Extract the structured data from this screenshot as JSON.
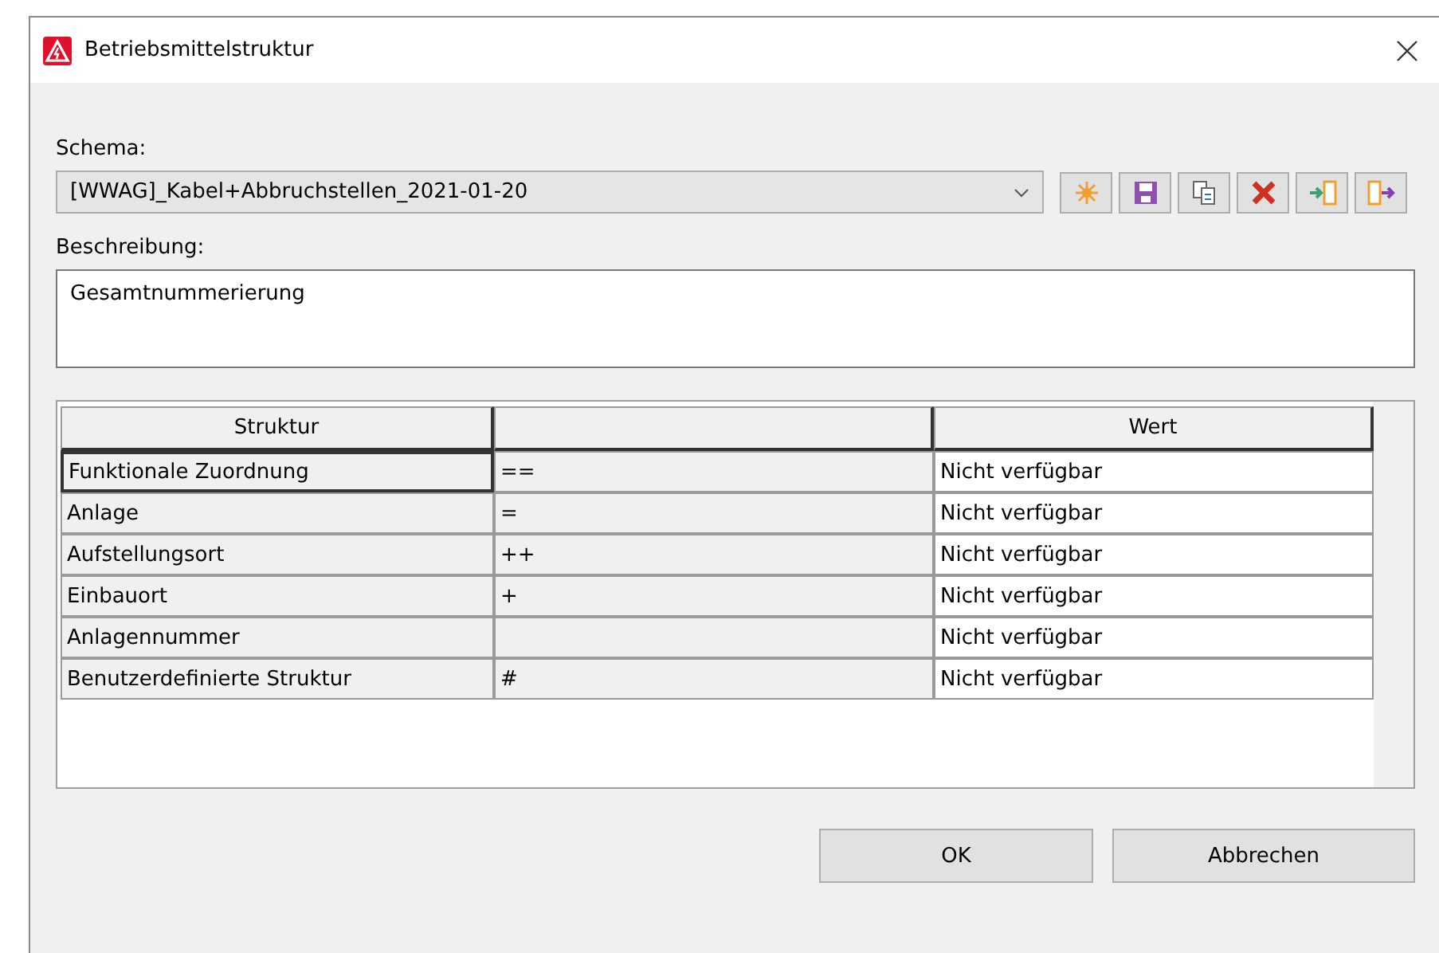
{
  "window": {
    "title": "Betriebsmittelstruktur"
  },
  "schema": {
    "label": "Schema:",
    "value": "[WWAG]_Kabel+Abbruchstellen_2021-01-20"
  },
  "toolbar": [
    {
      "kind": "new"
    },
    {
      "kind": "save"
    },
    {
      "kind": "copy"
    },
    {
      "kind": "delete"
    },
    {
      "kind": "import"
    },
    {
      "kind": "export"
    }
  ],
  "description": {
    "label": "Beschreibung:",
    "value": "Gesamtnummerierung"
  },
  "table": {
    "columns": [
      "Struktur",
      "",
      "Wert"
    ],
    "rows": [
      {
        "name": "Funktionale Zuordnung",
        "symbol": "==",
        "value": "Nicht verfügbar",
        "selected": true
      },
      {
        "name": "Anlage",
        "symbol": "=",
        "value": "Nicht verfügbar",
        "selected": false
      },
      {
        "name": "Aufstellungsort",
        "symbol": "++",
        "value": "Nicht verfügbar",
        "selected": false
      },
      {
        "name": "Einbauort",
        "symbol": "+",
        "value": "Nicht verfügbar",
        "selected": false
      },
      {
        "name": "Anlagennummer",
        "symbol": "",
        "value": "Nicht verfügbar",
        "selected": false
      },
      {
        "name": "Benutzerdefinierte Struktur",
        "symbol": "#",
        "value": "Nicht verfügbar",
        "selected": false
      }
    ]
  },
  "buttons": [
    "OK",
    "Abbrechen"
  ]
}
